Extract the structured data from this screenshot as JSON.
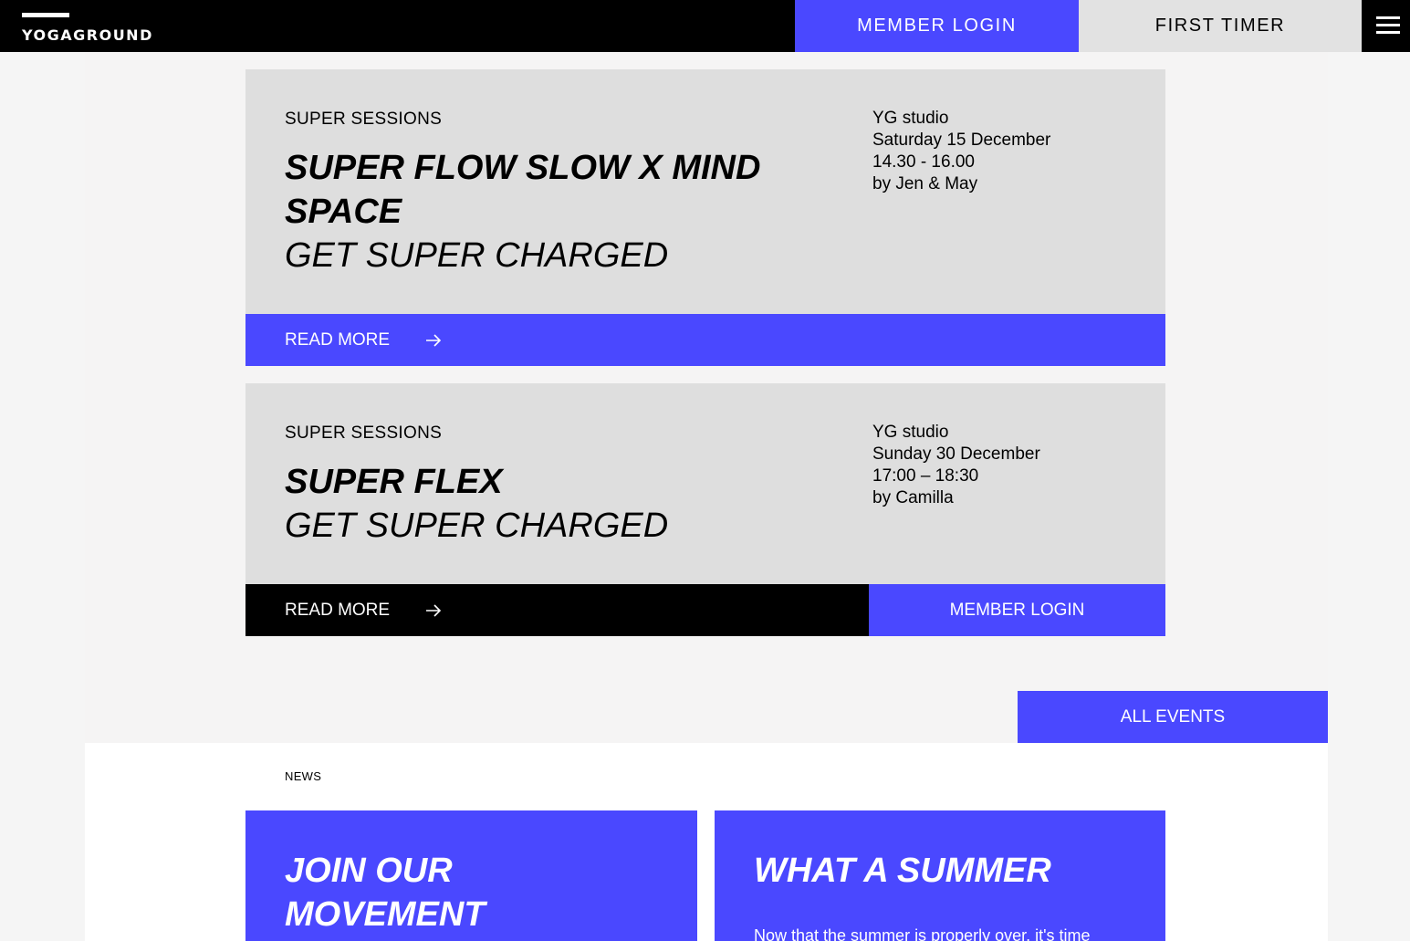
{
  "header": {
    "logo_text": "YOGAGROUND",
    "member_login": "MEMBER LOGIN",
    "first_timer": "FIRST TIMER"
  },
  "events": [
    {
      "category": "SUPER SESSIONS",
      "title": "SUPER FLOW SLOW X MIND SPACE",
      "subtitle": "GET SUPER CHARGED",
      "location": "YG studio",
      "date": "Saturday 15 December",
      "time": "14.30 - 16.00",
      "host": "by Jen & May",
      "read_more": "READ MORE"
    },
    {
      "category": "SUPER SESSIONS",
      "title": "SUPER FLEX",
      "subtitle": "GET SUPER CHARGED",
      "location": "YG studio",
      "date": "Sunday 30 December",
      "time": "17:00 – 18:30",
      "host": "by Camilla",
      "read_more": "READ MORE",
      "member_login": "MEMBER LOGIN"
    }
  ],
  "all_events": "ALL EVENTS",
  "news": {
    "label": "NEWS",
    "items": [
      {
        "title": "JOIN OUR MOVEMENT"
      },
      {
        "title": "WHAT A SUMMER",
        "excerpt": "Now that the summer is properly over, it's time"
      }
    ]
  },
  "colors": {
    "accent": "#4a48ff",
    "black": "#000000",
    "card_gray": "#dedede"
  }
}
